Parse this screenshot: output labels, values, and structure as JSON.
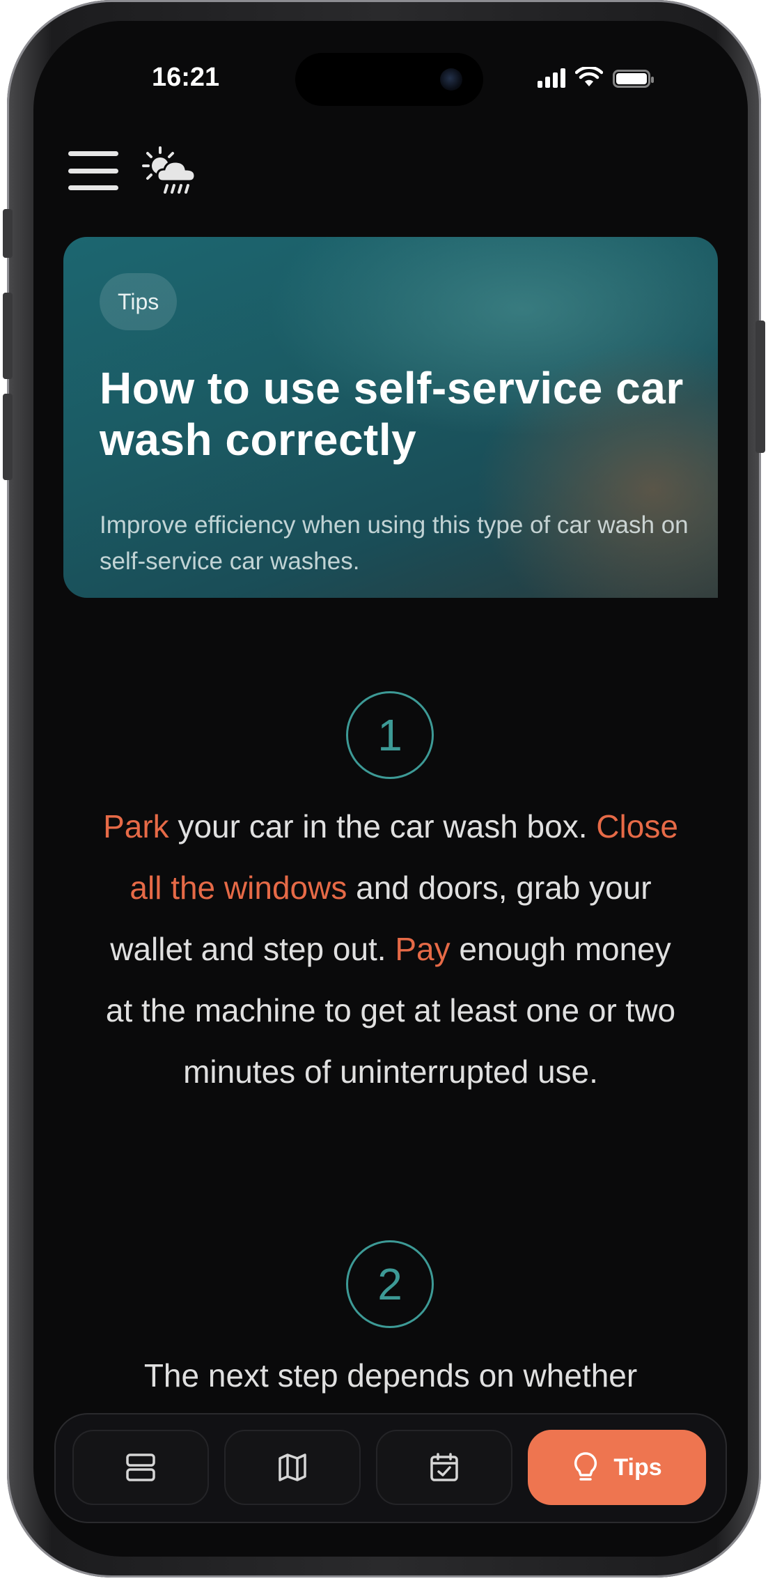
{
  "status_bar": {
    "time": "16:21",
    "signal_icon": "cellular-signal-icon",
    "wifi_icon": "wifi-icon",
    "battery_icon": "battery-icon"
  },
  "header": {
    "menu_icon": "hamburger-menu-icon",
    "weather_icon": "sun-cloud-rain-icon"
  },
  "hero": {
    "badge": "Tips",
    "title": "How to use self-service car wash correctly",
    "subtitle": "Improve efficiency when using this type of car wash on self-service car washes."
  },
  "steps": [
    {
      "number": "1",
      "segments": [
        {
          "text": "Park",
          "highlight": true
        },
        {
          "text": " your car in the car wash box. ",
          "highlight": false
        },
        {
          "text": "Close all the windows",
          "highlight": true
        },
        {
          "text": " and doors, grab your wallet and step out. ",
          "highlight": false
        },
        {
          "text": "Pay",
          "highlight": true
        },
        {
          "text": " enough money at the machine to get at least one or two minutes of uninterrupted use.",
          "highlight": false
        }
      ]
    },
    {
      "number": "2",
      "segments": [
        {
          "text": "The next step depends on whether",
          "highlight": false
        }
      ]
    }
  ],
  "bottom_nav": {
    "items": [
      {
        "icon": "list-layout-icon",
        "label": ""
      },
      {
        "icon": "map-icon",
        "label": ""
      },
      {
        "icon": "calendar-check-icon",
        "label": ""
      },
      {
        "icon": "lightbulb-icon",
        "label": "Tips",
        "active": true
      }
    ]
  },
  "colors": {
    "background": "#0a0a0b",
    "accent_orange": "#e66a47",
    "accent_teal": "#3d9a96",
    "active_tab": "#ee7550"
  }
}
